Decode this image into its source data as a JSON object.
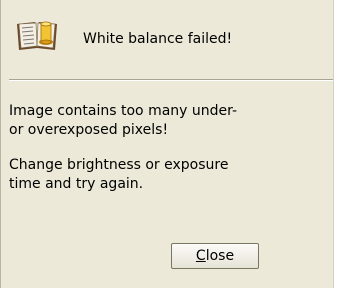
{
  "dialog": {
    "icon": "open-book-with-coin-icon",
    "title": "White balance failed!",
    "message": {
      "line1": "Image contains too many under-",
      "line2": "or overexposed pixels!",
      "line3": "Change brightness or exposure",
      "line4": "time and try again."
    },
    "close_button": {
      "mnemonic": "C",
      "rest": "lose"
    }
  }
}
